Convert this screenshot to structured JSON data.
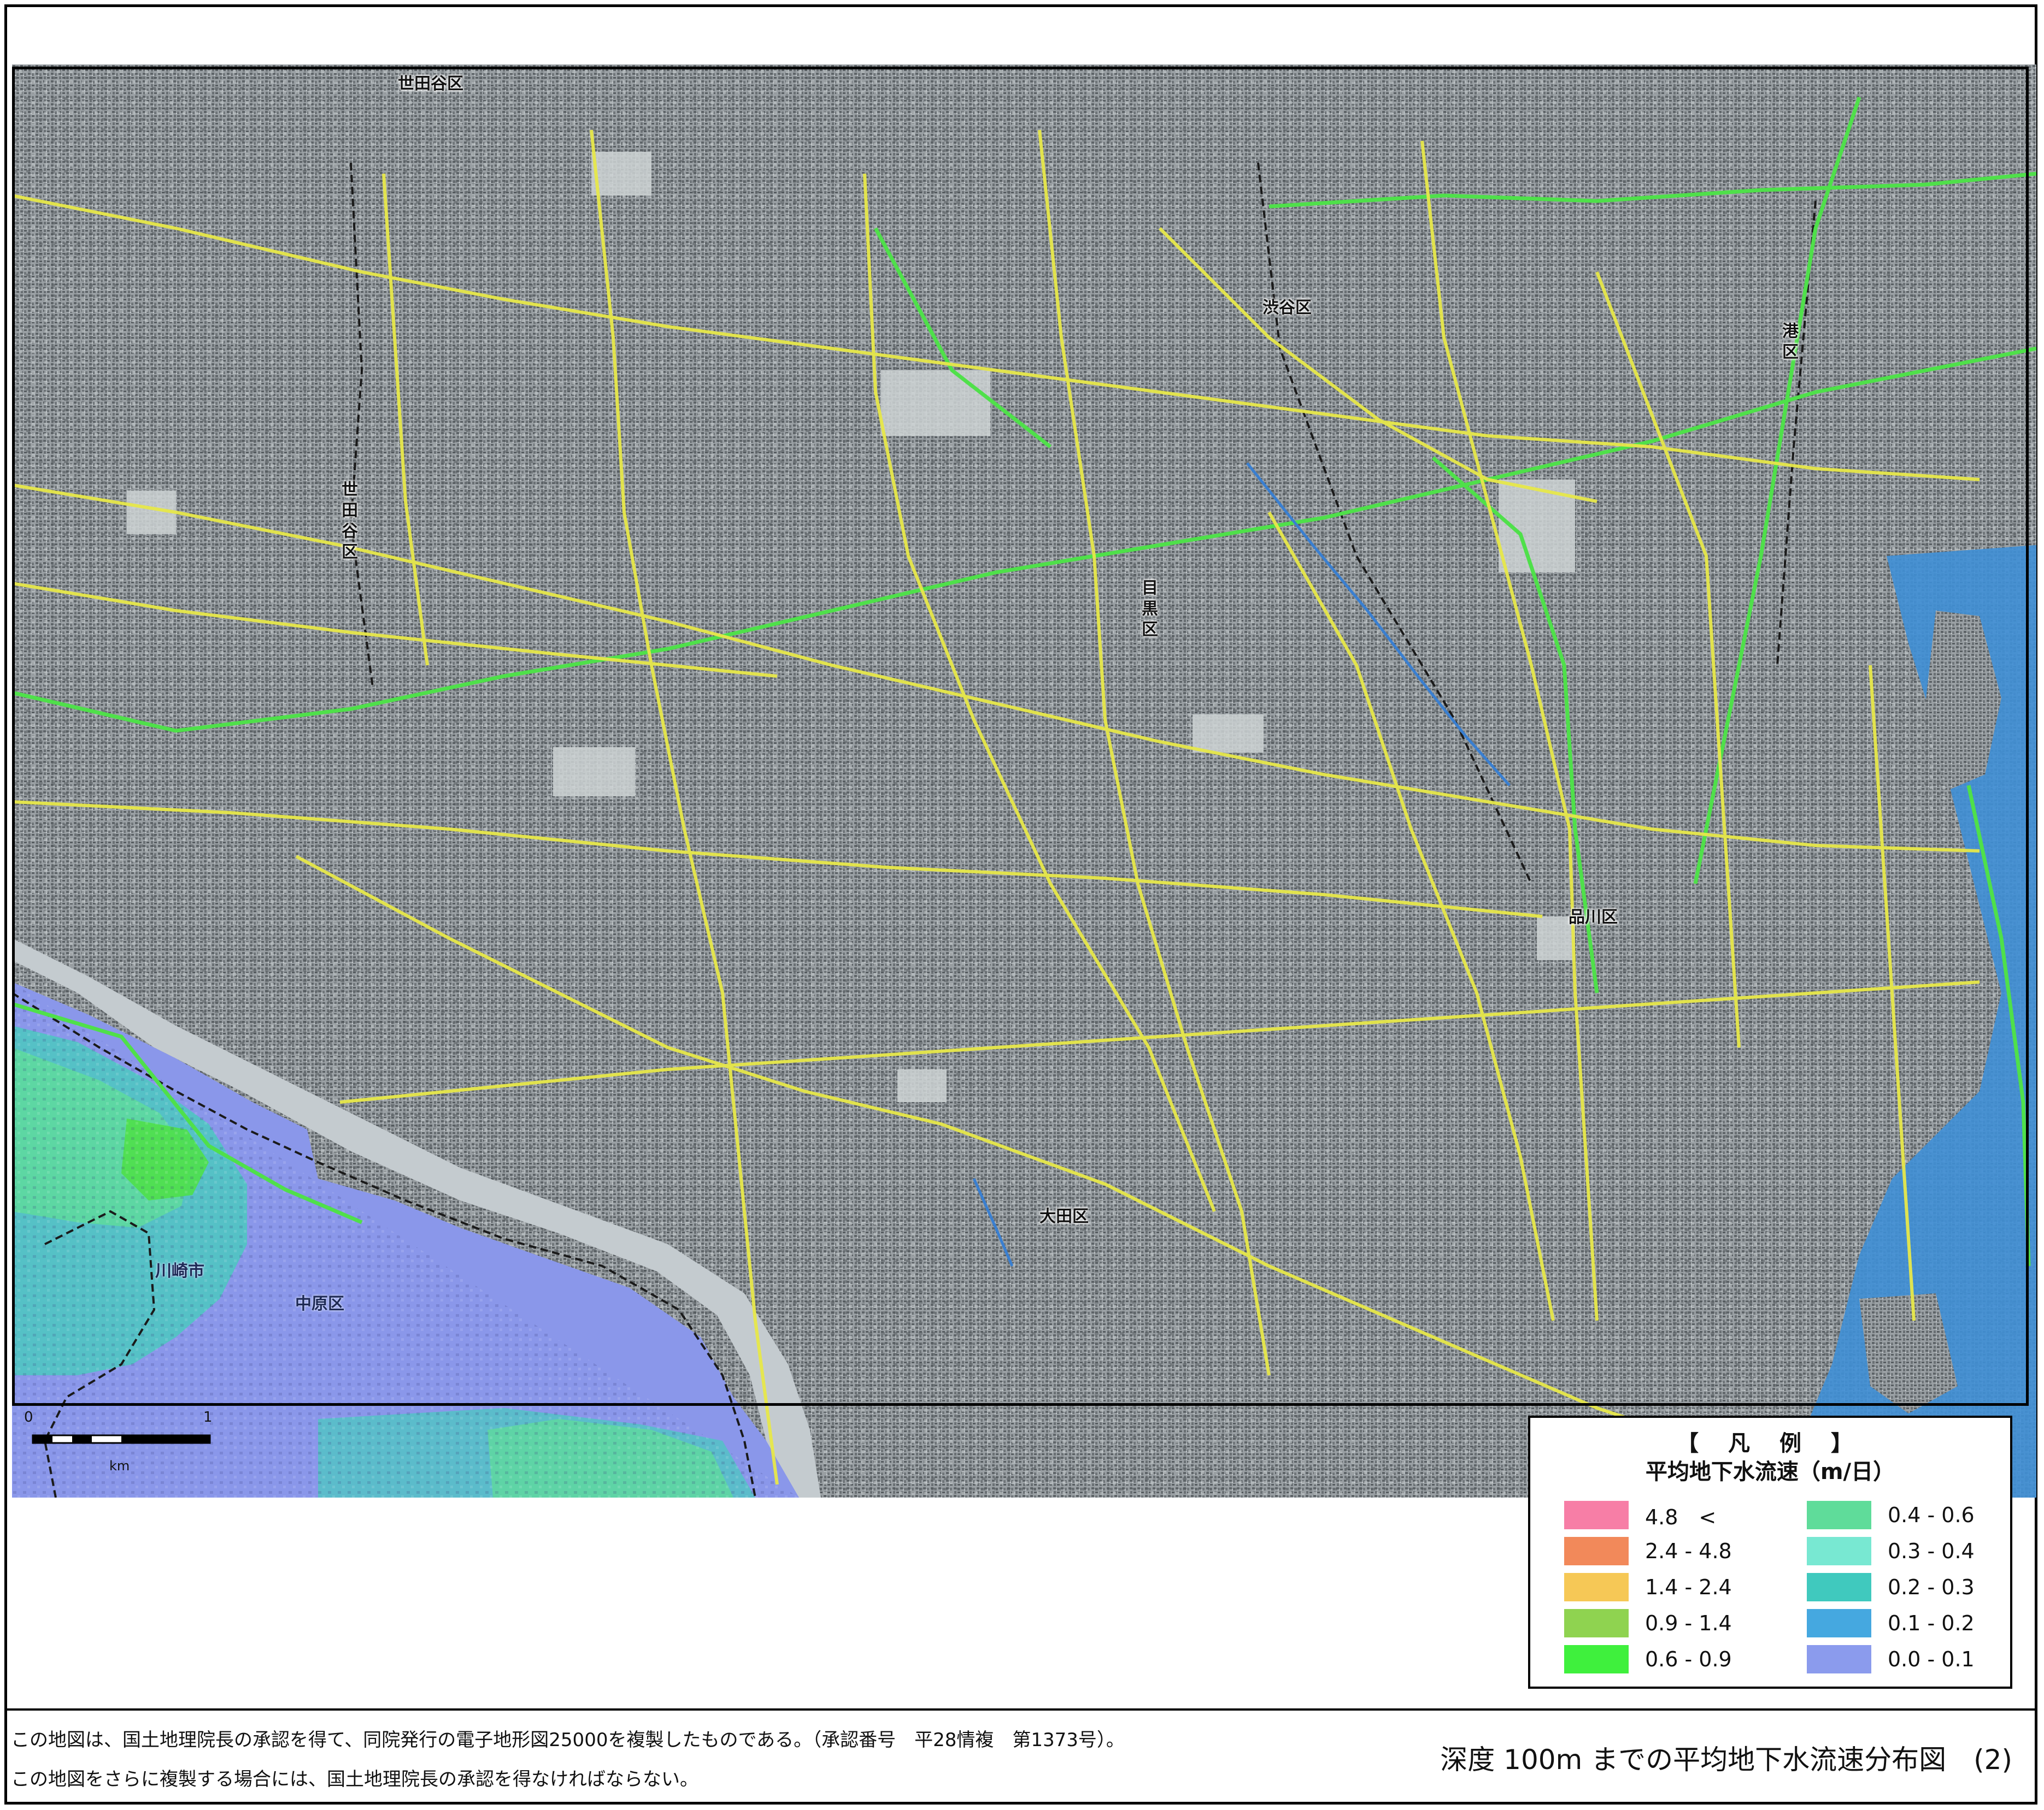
{
  "map": {
    "place_labels": [
      {
        "name": "setagaya-ku-north",
        "text": "世田谷区"
      },
      {
        "name": "setagaya-ku-west",
        "text": "世田谷区"
      },
      {
        "name": "shibuya-ku",
        "text": "渋谷区"
      },
      {
        "name": "minato-ku",
        "text": "港区"
      },
      {
        "name": "meguro-ku",
        "text": "目黒区"
      },
      {
        "name": "shinagawa-ku",
        "text": "品川区"
      },
      {
        "name": "ota-ku",
        "text": "大田区"
      },
      {
        "name": "kawasaki-shi",
        "text": "川崎市"
      },
      {
        "name": "nakahara-ku",
        "text": "中原区"
      }
    ],
    "colors": {
      "base_map": "#8d9397",
      "road_major": "#e7e84a",
      "rail": "#4fe04a",
      "water": "#3f8fd6",
      "overlay_low": "#8a97ea",
      "overlay_mid": "#4bc8c0",
      "overlay_high": "#4fe04a"
    }
  },
  "scalebar": {
    "start": "0",
    "end": "1",
    "unit": "km"
  },
  "legend": {
    "title": "【 凡 例 】",
    "subtitle": "平均地下水流速（m/日）",
    "items": [
      {
        "label": "4.8　<",
        "color": "#f77ea6"
      },
      {
        "label": "2.4 - 4.8",
        "color": "#f2895a"
      },
      {
        "label": "1.4 - 2.4",
        "color": "#f6c856"
      },
      {
        "label": "0.9 - 1.4",
        "color": "#8fd350"
      },
      {
        "label": "0.6 - 0.9",
        "color": "#3ff03d"
      },
      {
        "label": "0.4 - 0.6",
        "color": "#5fdc9a"
      },
      {
        "label": "0.3 - 0.4",
        "color": "#78e8d2"
      },
      {
        "label": "0.2 - 0.3",
        "color": "#40c9be"
      },
      {
        "label": "0.1 - 0.2",
        "color": "#45a8e0"
      },
      {
        "label": "0.0 - 0.1",
        "color": "#8b9bed"
      }
    ]
  },
  "footer": {
    "line1": "この地図は、国土地理院長の承認を得て、同院発行の電子地形図25000を複製したものである。（承認番号　平28情複　第1373号）。",
    "line2": "この地図をさらに複製する場合には、国土地理院長の承認を得なければならない。",
    "title": "深度 100m までの平均地下水流速分布図　(2)"
  }
}
